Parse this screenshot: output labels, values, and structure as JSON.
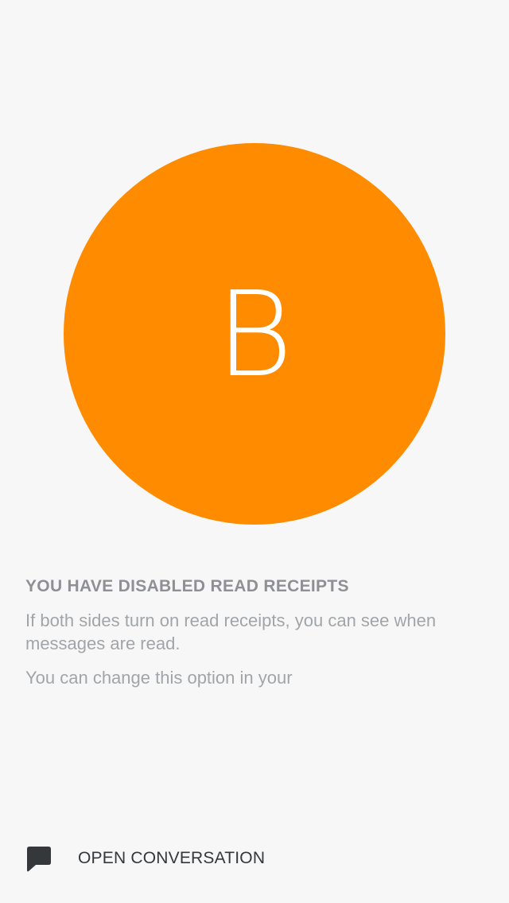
{
  "avatar": {
    "initial": "B",
    "color": "#ff8c00"
  },
  "read_receipts": {
    "title": "YOU HAVE DISABLED READ RECEIPTS",
    "description": "If both sides turn on read receipts, you can see when messages are read.",
    "hint": "You can change this option in your"
  },
  "actions": {
    "open_conversation_label": "OPEN CONVERSATION",
    "open_conversation_icon": "chat-bubble-icon"
  },
  "colors": {
    "background": "#f7f7f7",
    "title_text": "#8e9093",
    "body_text": "#a2a5a8",
    "action_text": "#34383b"
  }
}
